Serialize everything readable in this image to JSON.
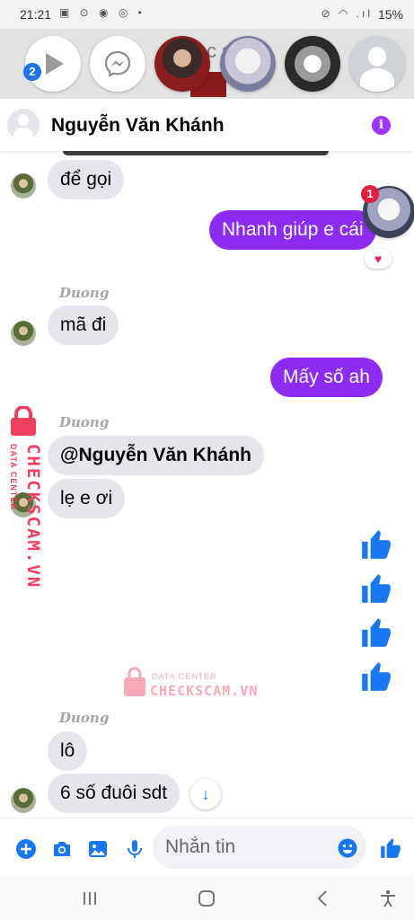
{
  "status_bar": {
    "time": "21:21",
    "notification_icons": "▣ ⊙ ◉ ◎ •",
    "system_icons": "⊘ ◠ .ıl",
    "battery": "15%"
  },
  "chat_heads": {
    "unread_badge": "2",
    "background_text": "c   sc  m.",
    "floating_badge": "1"
  },
  "chat_header": {
    "name": "Nguyễn Văn Khánh",
    "info_icon": "i"
  },
  "messages": [
    {
      "id": "m1",
      "direction": "in",
      "text": "để gọi"
    },
    {
      "id": "m2",
      "direction": "out",
      "text": "Nhanh giúp e cái",
      "reaction": "♥"
    },
    {
      "id": "m3",
      "direction": "in",
      "sender": "Duong",
      "text": "mã đi"
    },
    {
      "id": "m4",
      "direction": "out",
      "text": "Mấy số ah"
    },
    {
      "id": "m5",
      "direction": "in",
      "sender": "Duong",
      "text": "@Nguyễn Văn Khánh"
    },
    {
      "id": "m6",
      "direction": "in",
      "text": "lẹ e ơi"
    },
    {
      "id": "m7",
      "direction": "out",
      "type": "like",
      "count": 4
    },
    {
      "id": "m8",
      "direction": "in",
      "sender": "Duong",
      "text": "lô"
    },
    {
      "id": "m9",
      "direction": "in",
      "text": "6 số đuôi sdt"
    }
  ],
  "scroll_down_icon": "↓",
  "watermark": {
    "brand": "CHECKSCAM.VN",
    "sub": "DATA CENTER"
  },
  "composer": {
    "placeholder": "Nhắn tin",
    "icons": [
      "add-icon",
      "camera-icon",
      "gallery-icon",
      "microphone-icon",
      "emoji-icon",
      "like-icon"
    ]
  },
  "colors": {
    "outgoing_bubble": "#8c2cf2",
    "incoming_bubble": "#e4e6eb",
    "accent_blue": "#1877f2",
    "info_purple": "#a033ff",
    "watermark_pink": "#ef3f5f"
  }
}
